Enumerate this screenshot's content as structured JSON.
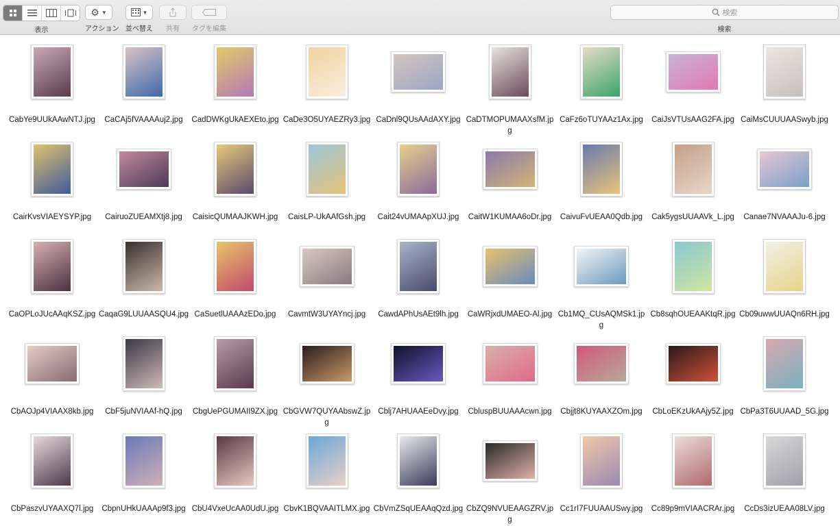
{
  "toolbar": {
    "view_label": "表示",
    "action_label": "アクション",
    "arrange_label": "並べ替え",
    "share_label": "共有",
    "tags_label": "タグを編集",
    "search_placeholder": "検索",
    "search_label": "検索"
  },
  "colors": {
    "toolbar_bg": "#e6e6e6",
    "active_segment": "#7b7b7b",
    "window_bg": "#ffffff"
  },
  "files": [
    {
      "name": "CabYe9UUkAAwNTJ.jpg",
      "orient": "portrait",
      "tone": [
        "#c9a9b6",
        "#5a3b4a"
      ]
    },
    {
      "name": "CaCAj5fVAAAAuj2.jpg",
      "orient": "portrait",
      "tone": [
        "#d9c2c8",
        "#3e6aa8"
      ]
    },
    {
      "name": "CadDWKgUkAEXEto.jpg",
      "orient": "portrait",
      "tone": [
        "#e4c96a",
        "#b07ab5"
      ]
    },
    {
      "name": "CaDe3O5UYAEZRy3.jpg",
      "orient": "portrait",
      "tone": [
        "#f1d39c",
        "#f7eee0"
      ]
    },
    {
      "name": "CaDnl9QUsAAdAXY.jpg",
      "orient": "landscape",
      "tone": [
        "#d4c4c0",
        "#9aa7c4"
      ]
    },
    {
      "name": "CaDTMOPUMAAXsfM.jpg",
      "orient": "portrait",
      "tone": [
        "#e8e2de",
        "#6b4a5a"
      ]
    },
    {
      "name": "CaFz6oTUYAAz1Ax.jpg",
      "orient": "portrait",
      "tone": [
        "#e6dcc8",
        "#3ca46a"
      ]
    },
    {
      "name": "CaiJsVTUsAAG2FA.jpg",
      "orient": "landscape",
      "tone": [
        "#c8b3d8",
        "#e07ab0"
      ]
    },
    {
      "name": "CaiMsCUUUAASwyb.jpg",
      "orient": "portrait",
      "tone": [
        "#ece6e2",
        "#c9bfb9"
      ]
    },
    {
      "name": "CairKvsVIAEYSYP.jpg",
      "orient": "portrait",
      "tone": [
        "#e0c26a",
        "#3f5a9e"
      ]
    },
    {
      "name": "CairuoZUEAMXtj8.jpg",
      "orient": "landscape",
      "tone": [
        "#c28a9a",
        "#4b3a5a"
      ]
    },
    {
      "name": "CaisicQUMAAJKWH.jpg",
      "orient": "portrait",
      "tone": [
        "#e7c97a",
        "#5a4a6a"
      ]
    },
    {
      "name": "CaisLP-UkAAfGsh.jpg",
      "orient": "portrait",
      "tone": [
        "#9cc6d8",
        "#e6c27a"
      ]
    },
    {
      "name": "Cait24vUMAApXUJ.jpg",
      "orient": "portrait",
      "tone": [
        "#e7d08c",
        "#8b6a9c"
      ]
    },
    {
      "name": "CaitW1KUMAA6oDr.jpg",
      "orient": "landscape",
      "tone": [
        "#8a7ab0",
        "#d4b474"
      ]
    },
    {
      "name": "CaivuFvUEAA0Qdb.jpg",
      "orient": "portrait",
      "tone": [
        "#6a7ab0",
        "#e7c47a"
      ]
    },
    {
      "name": "Cak5ygsUUAAVk_L.jpg",
      "orient": "portrait",
      "tone": [
        "#c4a08a",
        "#e8d6c8"
      ]
    },
    {
      "name": "Canae7NVAAAJu-6.jpg",
      "orient": "landscape",
      "tone": [
        "#e6c6d4",
        "#7aa0c8"
      ]
    },
    {
      "name": "CaOPLoJUcAAqKSZ.jpg",
      "orient": "portrait",
      "tone": [
        "#d6b0b0",
        "#4a3040"
      ]
    },
    {
      "name": "CaqaG9LUUAASQU4.jpg",
      "orient": "portrait",
      "tone": [
        "#3a3030",
        "#cbb8a8"
      ]
    },
    {
      "name": "CaSuetlUAAAzEDo.jpg",
      "orient": "portrait",
      "tone": [
        "#e9c46a",
        "#c04a6a"
      ]
    },
    {
      "name": "CavmtW3UYAYncj.jpg",
      "orient": "landscape",
      "tone": [
        "#d8c8c4",
        "#8a7a80"
      ]
    },
    {
      "name": "CawdAPhUsAEt9lh.jpg",
      "orient": "portrait",
      "tone": [
        "#a8b4cc",
        "#4a4a6a"
      ]
    },
    {
      "name": "CaWRjxdUMAEO-Al.jpg",
      "orient": "landscape",
      "tone": [
        "#e6c26a",
        "#6a8ac0"
      ]
    },
    {
      "name": "Cb1MQ_CUsAQMSk1.jpg",
      "orient": "landscape",
      "tone": [
        "#f4f4f4",
        "#6a9ac0"
      ]
    },
    {
      "name": "Cb8sqhOUEAAKtqR.jpg",
      "orient": "portrait",
      "tone": [
        "#8ac8d0",
        "#cfe6a0"
      ]
    },
    {
      "name": "Cb09uwwUUAQn6RH.jpg",
      "orient": "portrait",
      "tone": [
        "#f2efe6",
        "#e6d48a"
      ]
    },
    {
      "name": "CbAOJp4VIAAX8kb.jpg",
      "orient": "landscape",
      "tone": [
        "#e4ccc8",
        "#8a6a70"
      ]
    },
    {
      "name": "CbF5juNVIAAf-hQ.jpg",
      "orient": "portrait",
      "tone": [
        "#3a3a44",
        "#d0b8b8"
      ]
    },
    {
      "name": "CbgUePGUMAII9ZX.jpg",
      "orient": "portrait",
      "tone": [
        "#b89aa8",
        "#5a3a4a"
      ]
    },
    {
      "name": "CbGVW7QUYAAbswZ.jpg",
      "orient": "landscape",
      "tone": [
        "#2a1c1c",
        "#c89a6a"
      ]
    },
    {
      "name": "Cblj7AHUAAEeDvy.jpg",
      "orient": "landscape",
      "tone": [
        "#10102a",
        "#6a5ac0"
      ]
    },
    {
      "name": "CbluspBUUAAAcwn.jpg",
      "orient": "landscape",
      "tone": [
        "#d8b0a8",
        "#e06a8a"
      ]
    },
    {
      "name": "Cbjjt8KUYAAXZOm.jpg",
      "orient": "landscape",
      "tone": [
        "#d05a7a",
        "#b8a89a"
      ]
    },
    {
      "name": "CbLoEKzUkAAjy5Z.jpg",
      "orient": "landscape",
      "tone": [
        "#2a1a1a",
        "#d0503a"
      ]
    },
    {
      "name": "CbPa3T6UUAAD_5G.jpg",
      "orient": "portrait",
      "tone": [
        "#d8a8b0",
        "#7ab0c0"
      ]
    },
    {
      "name": "CbPaszvUYAAXQ7l.jpg",
      "orient": "portrait",
      "tone": [
        "#e8d8dc",
        "#4a3a48"
      ]
    },
    {
      "name": "CbpnUHkUAAAp9f3.jpg",
      "orient": "portrait",
      "tone": [
        "#6a7ab8",
        "#d0b0b8"
      ]
    },
    {
      "name": "CbU4VxeUcAA0UdU.jpg",
      "orient": "portrait",
      "tone": [
        "#5a3a44",
        "#e6c8c0"
      ]
    },
    {
      "name": "CbvK1BQVAAITLMX.jpg",
      "orient": "portrait",
      "tone": [
        "#6aa8d8",
        "#e8d0c8"
      ]
    },
    {
      "name": "CbVmZSqUEAAqQzd.jpg",
      "orient": "portrait",
      "tone": [
        "#e8e8ec",
        "#3a3a5a"
      ]
    },
    {
      "name": "CbZQ9NVUEAAGZRV.jpg",
      "orient": "landscape",
      "tone": [
        "#2a2a2a",
        "#e0b0a8"
      ]
    },
    {
      "name": "Cc1rI7FUUAAUSwy.jpg",
      "orient": "portrait",
      "tone": [
        "#f0c8a8",
        "#9a8ab0"
      ]
    },
    {
      "name": "Cc89p9mVIAACRAr.jpg",
      "orient": "portrait",
      "tone": [
        "#eadcd8",
        "#b06a70"
      ]
    },
    {
      "name": "CcDs3izUEAA08LV.jpg",
      "orient": "portrait",
      "tone": [
        "#d8d8d8",
        "#a0a0a8"
      ]
    }
  ]
}
